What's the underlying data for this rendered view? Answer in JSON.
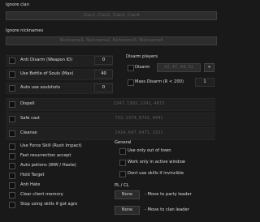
{
  "ignore_clan": {
    "title": "Ignore clan",
    "placeholder": "Clan1, Clan2, Clan3, Clan4"
  },
  "ignore_nicknames": {
    "title": "Ignore nicknames",
    "placeholder": "Nickname1, Nickname2, Nickname3, Nickname4"
  },
  "left_options": [
    {
      "label": "Anti Disarm (Weapon ID)",
      "value": "0"
    },
    {
      "label": "Use Bottle of Souls (Max)",
      "value": "40"
    },
    {
      "label": "Auto use soulshots",
      "value": "0"
    }
  ],
  "id_rows": [
    {
      "label": "Dispell",
      "value": "1347, 1582, 2241, 4672"
    },
    {
      "label": "Safe cast",
      "value": "753, 1374, 6741, 9441"
    },
    {
      "label": "Cleanse",
      "value": "1424, 647, 6471, 3321"
    }
  ],
  "disarm": {
    "title": "Disarm players",
    "disarm_label": "Disarm",
    "disarm_value": "10, 47, 94, 31",
    "add_icon": "+",
    "mass_label": "Mass Disarm (R < 200)",
    "mass_value": "1"
  },
  "bottom_left": [
    "Use Force Skill (Rush Impact)",
    "Fast resurrection accept",
    "Auto potions (WW / Haste)",
    "Hold Target",
    "Anti Hate",
    "Clear client memory",
    "Stop using skills if got agro"
  ],
  "general": {
    "title": "General",
    "items": [
      "Use only out of town",
      "Work only in active window",
      "Dont use skills if invincible"
    ]
  },
  "pl_cl": {
    "title": "PL / CL",
    "rows": [
      {
        "value": "None",
        "label": "- Move to party leader"
      },
      {
        "value": "None",
        "label": "- Move to clan leader"
      }
    ]
  }
}
